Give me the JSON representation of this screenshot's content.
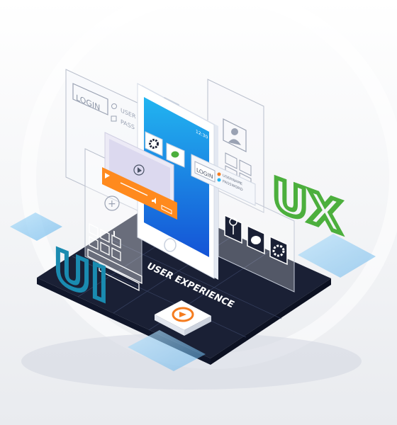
{
  "wireframe_left": {
    "login_label": "LOGIN",
    "username_label": "USER",
    "password_label": "PASS"
  },
  "phone": {
    "time": "12:30",
    "login_card": {
      "title": "LOGIN",
      "username_label": "USERNAME",
      "password_label": "PASSWORD"
    }
  },
  "platform": {
    "caption": "USER EXPERIENCE"
  },
  "big_letters": {
    "ui": "UI",
    "ux": "UX"
  },
  "colors": {
    "background": "#f3f4f6",
    "platform": "#1a2035",
    "phone_screen_top": "#22b5f0",
    "phone_screen_bottom": "#1453d6",
    "ux_green": "#4caf3d",
    "ui_teal": "#1a8bb0",
    "video_bar_orange": "#ff8a1e",
    "play_button_orange": "#f57c1f"
  }
}
